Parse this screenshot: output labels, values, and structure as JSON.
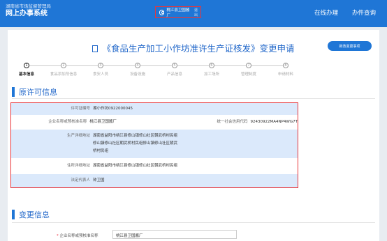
{
  "header": {
    "org": "湖南省市场监督管理局",
    "system": "网上办事系统",
    "user": "桃江县卫国酱厂",
    "logout": "退出",
    "nav": [
      "在线办理",
      "办件查询"
    ]
  },
  "page": {
    "title": "《食品生产加工小作坊准许生产证核发》变更申请",
    "change_button": "新改变更事项"
  },
  "steps": [
    {
      "num": "1",
      "label": "基本信息",
      "active": true
    },
    {
      "num": "2",
      "label": "食品添加剂信息",
      "active": false
    },
    {
      "num": "3",
      "label": "食安人员",
      "active": false
    },
    {
      "num": "4",
      "label": "设备设施",
      "active": false
    },
    {
      "num": "5",
      "label": "产品信息",
      "active": false
    },
    {
      "num": "6",
      "label": "加工场所",
      "active": false
    },
    {
      "num": "7",
      "label": "管理制度",
      "active": false
    },
    {
      "num": "8",
      "label": "申请材料",
      "active": false
    }
  ],
  "section_original": {
    "title": "原许可信息",
    "license_no_label": "许可证编号",
    "license_no": "湘小作坊0922000045",
    "company_label": "企业名称或预核准名称",
    "company": "桃江县卫国酱厂",
    "credit_label": "统一社会信用代码",
    "credit": "92430922MA4NP4WG7T",
    "prod_addr_label": "生产详细地址",
    "prod_addr_lines": [
      "湖南省益阳市桃江县修山镇修山社区朝武桥村民组",
      "修山镇修山社区朝武桥村民组修山镇修山社区朝武",
      "桥村民组"
    ],
    "res_addr_label": "住所详细地址",
    "res_addr": "湖南省益阳市桃江县修山镇修山社区朝武桥村民组",
    "legal_label": "法定代表人",
    "legal": "钟卫国"
  },
  "section_change": {
    "title": "变更信息",
    "company_label": "企业名称或预核准名称",
    "company_value": "桃江县卫国酱厂"
  },
  "colors": {
    "topbar": "#1f76d6",
    "highlight": "#e8363a",
    "row_blue": "#dbe9fb"
  }
}
